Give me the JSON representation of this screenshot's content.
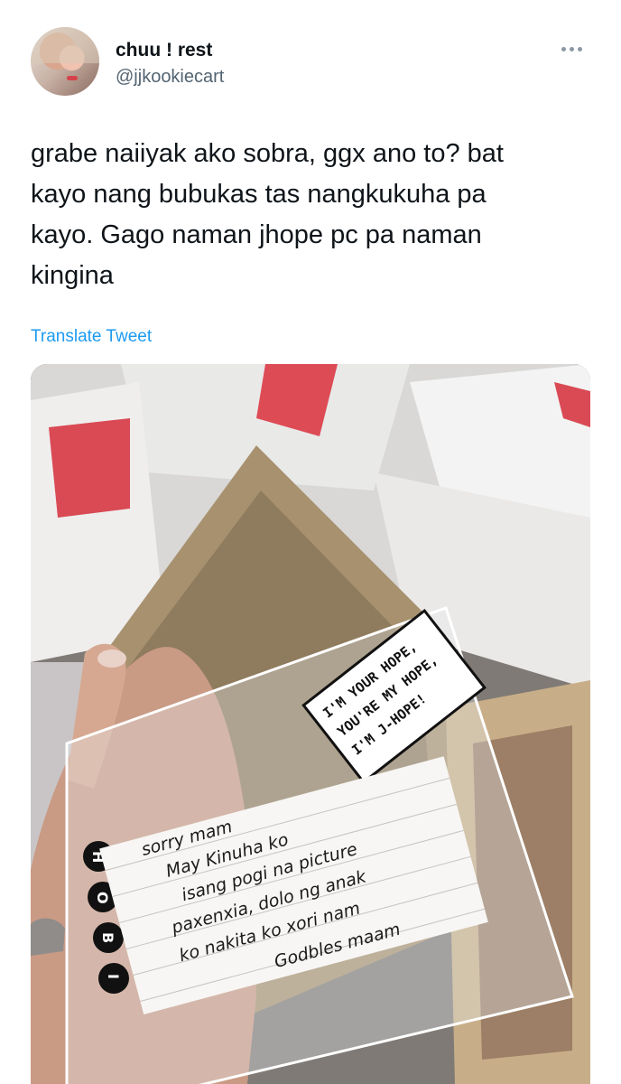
{
  "user": {
    "display_name": "chuu ! rest",
    "handle": "@jjkookiecart"
  },
  "tweet": {
    "text": "grabe naiiyak ako sobra, ggx ano to? bat\nkayo nang bubukas tas nangkukuha pa\nkayo. Gago naman jhope pc pa naman\nkingina",
    "translate_label": "Translate Tweet"
  },
  "photo": {
    "bubble_lines": [
      "I'M YOUR HOPE,",
      "YOU'RE MY HOPE,",
      "I'M J-HOPE!"
    ],
    "sleeve_letters": [
      "H",
      "O",
      "B",
      "I"
    ],
    "note_lines": [
      "sorry mam",
      "May Kinuha ko",
      "isang pogi na picture",
      "paxenxia, dolo ng anak",
      "ko nakita ko xori nam",
      "Godbles maam"
    ]
  },
  "icons": {
    "more": "more-dots-icon"
  }
}
